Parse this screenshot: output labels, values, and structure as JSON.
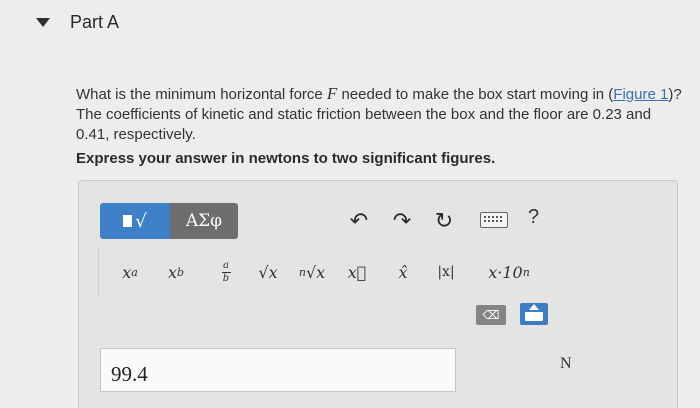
{
  "part": {
    "title": "Part A"
  },
  "question": {
    "pre": "What is the minimum horizontal force ",
    "force_var": "F",
    "mid": " needed to make the box start moving in (",
    "figure_link": "Figure 1",
    "post": ")? The coefficients of kinetic and static friction between the box and the floor are 0.23 and 0.41, respectively."
  },
  "instruction": "Express your answer in newtons to two significant figures.",
  "toolbar": {
    "greek_label": "ΑΣφ",
    "templates_glyph": "√",
    "undo_glyph": "↶",
    "redo_glyph": "↷",
    "reset_glyph": "↻",
    "help_label": "?"
  },
  "templates": {
    "exponent": {
      "base": "x",
      "sup": "a"
    },
    "subscript": {
      "base": "x",
      "sub": "b"
    },
    "fraction": {
      "num": "a",
      "den": "b"
    },
    "sqrt": "√x",
    "nroot": {
      "n": "n",
      "body": "√x"
    },
    "vector": "x⃗",
    "unit_vector": "x̂",
    "abs": "|x|",
    "sci": "x·10",
    "sci_sup": "n"
  },
  "backspace_glyph": "⌫",
  "answer": {
    "value": "99.4",
    "unit": "N"
  },
  "colors": {
    "accent": "#3d80c8",
    "greek_bg": "#6e6e6e",
    "link": "#3a6fb5"
  },
  "icons": [
    "collapse-triangle-icon",
    "templates-icon",
    "undo-icon",
    "redo-icon",
    "reset-icon",
    "keyboard-icon",
    "help-icon",
    "backspace-icon",
    "keyboard-toggle-icon"
  ]
}
